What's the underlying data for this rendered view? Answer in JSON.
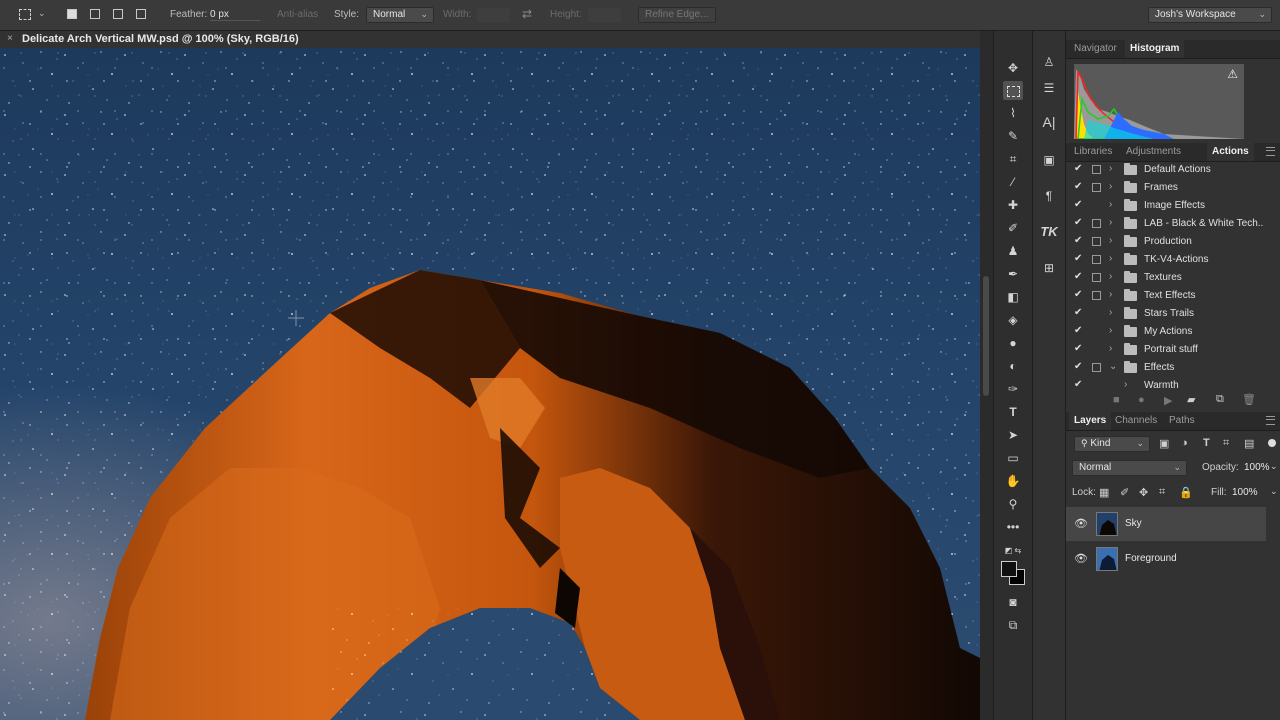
{
  "options_bar": {
    "feather_label": "Feather:",
    "feather_value": "0 px",
    "antialias_label": "Anti-alias",
    "style_label": "Style:",
    "style_value": "Normal",
    "width_label": "Width:",
    "height_label": "Height:",
    "refine_edge": "Refine Edge...",
    "workspace": "Josh's Workspace"
  },
  "document": {
    "tab_title": "Delicate Arch Vertical MW.psd @ 100% (Sky, RGB/16)",
    "close_glyph": "×"
  },
  "panels": {
    "top_tabs": [
      "Navigator",
      "Histogram"
    ],
    "top_active": "Histogram",
    "histogram_warning": "⚠",
    "middle_tabs": [
      "Libraries",
      "Adjustments",
      "Actions"
    ],
    "middle_active": "Actions",
    "actions": [
      {
        "name": "Default Actions",
        "dialog": true,
        "expanded": false,
        "type": "set"
      },
      {
        "name": "Frames",
        "dialog": true,
        "expanded": false,
        "type": "set"
      },
      {
        "name": "Image Effects",
        "dialog": false,
        "expanded": false,
        "type": "set"
      },
      {
        "name": "LAB - Black & White Tech...",
        "dialog": true,
        "expanded": false,
        "type": "set"
      },
      {
        "name": "Production",
        "dialog": true,
        "expanded": false,
        "type": "set"
      },
      {
        "name": "TK-V4-Actions",
        "dialog": true,
        "expanded": false,
        "type": "set"
      },
      {
        "name": "Textures",
        "dialog": true,
        "expanded": false,
        "type": "set"
      },
      {
        "name": "Text Effects",
        "dialog": true,
        "expanded": false,
        "type": "set"
      },
      {
        "name": "Stars Trails",
        "dialog": false,
        "expanded": false,
        "type": "set"
      },
      {
        "name": "My Actions",
        "dialog": false,
        "expanded": false,
        "type": "set"
      },
      {
        "name": "Portrait stuff",
        "dialog": false,
        "expanded": false,
        "type": "set"
      },
      {
        "name": "Effects",
        "dialog": true,
        "expanded": true,
        "type": "set"
      },
      {
        "name": "Warmth",
        "dialog": false,
        "expanded": false,
        "type": "action"
      }
    ],
    "layers_tabs": [
      "Layers",
      "Channels",
      "Paths"
    ],
    "layers_active": "Layers",
    "kind_label": "Kind",
    "blend_mode": "Normal",
    "opacity_label": "Opacity:",
    "opacity_value": "100%",
    "lock_label": "Lock:",
    "fill_label": "Fill:",
    "fill_value": "100%",
    "layers": [
      {
        "name": "Sky",
        "selected": true
      },
      {
        "name": "Foreground",
        "selected": false
      }
    ]
  },
  "colors": {
    "ui_dark": "#323232",
    "sky": "#17314f",
    "rock_lit": "#c65a0f",
    "rock_shadow": "#1a0c06"
  }
}
